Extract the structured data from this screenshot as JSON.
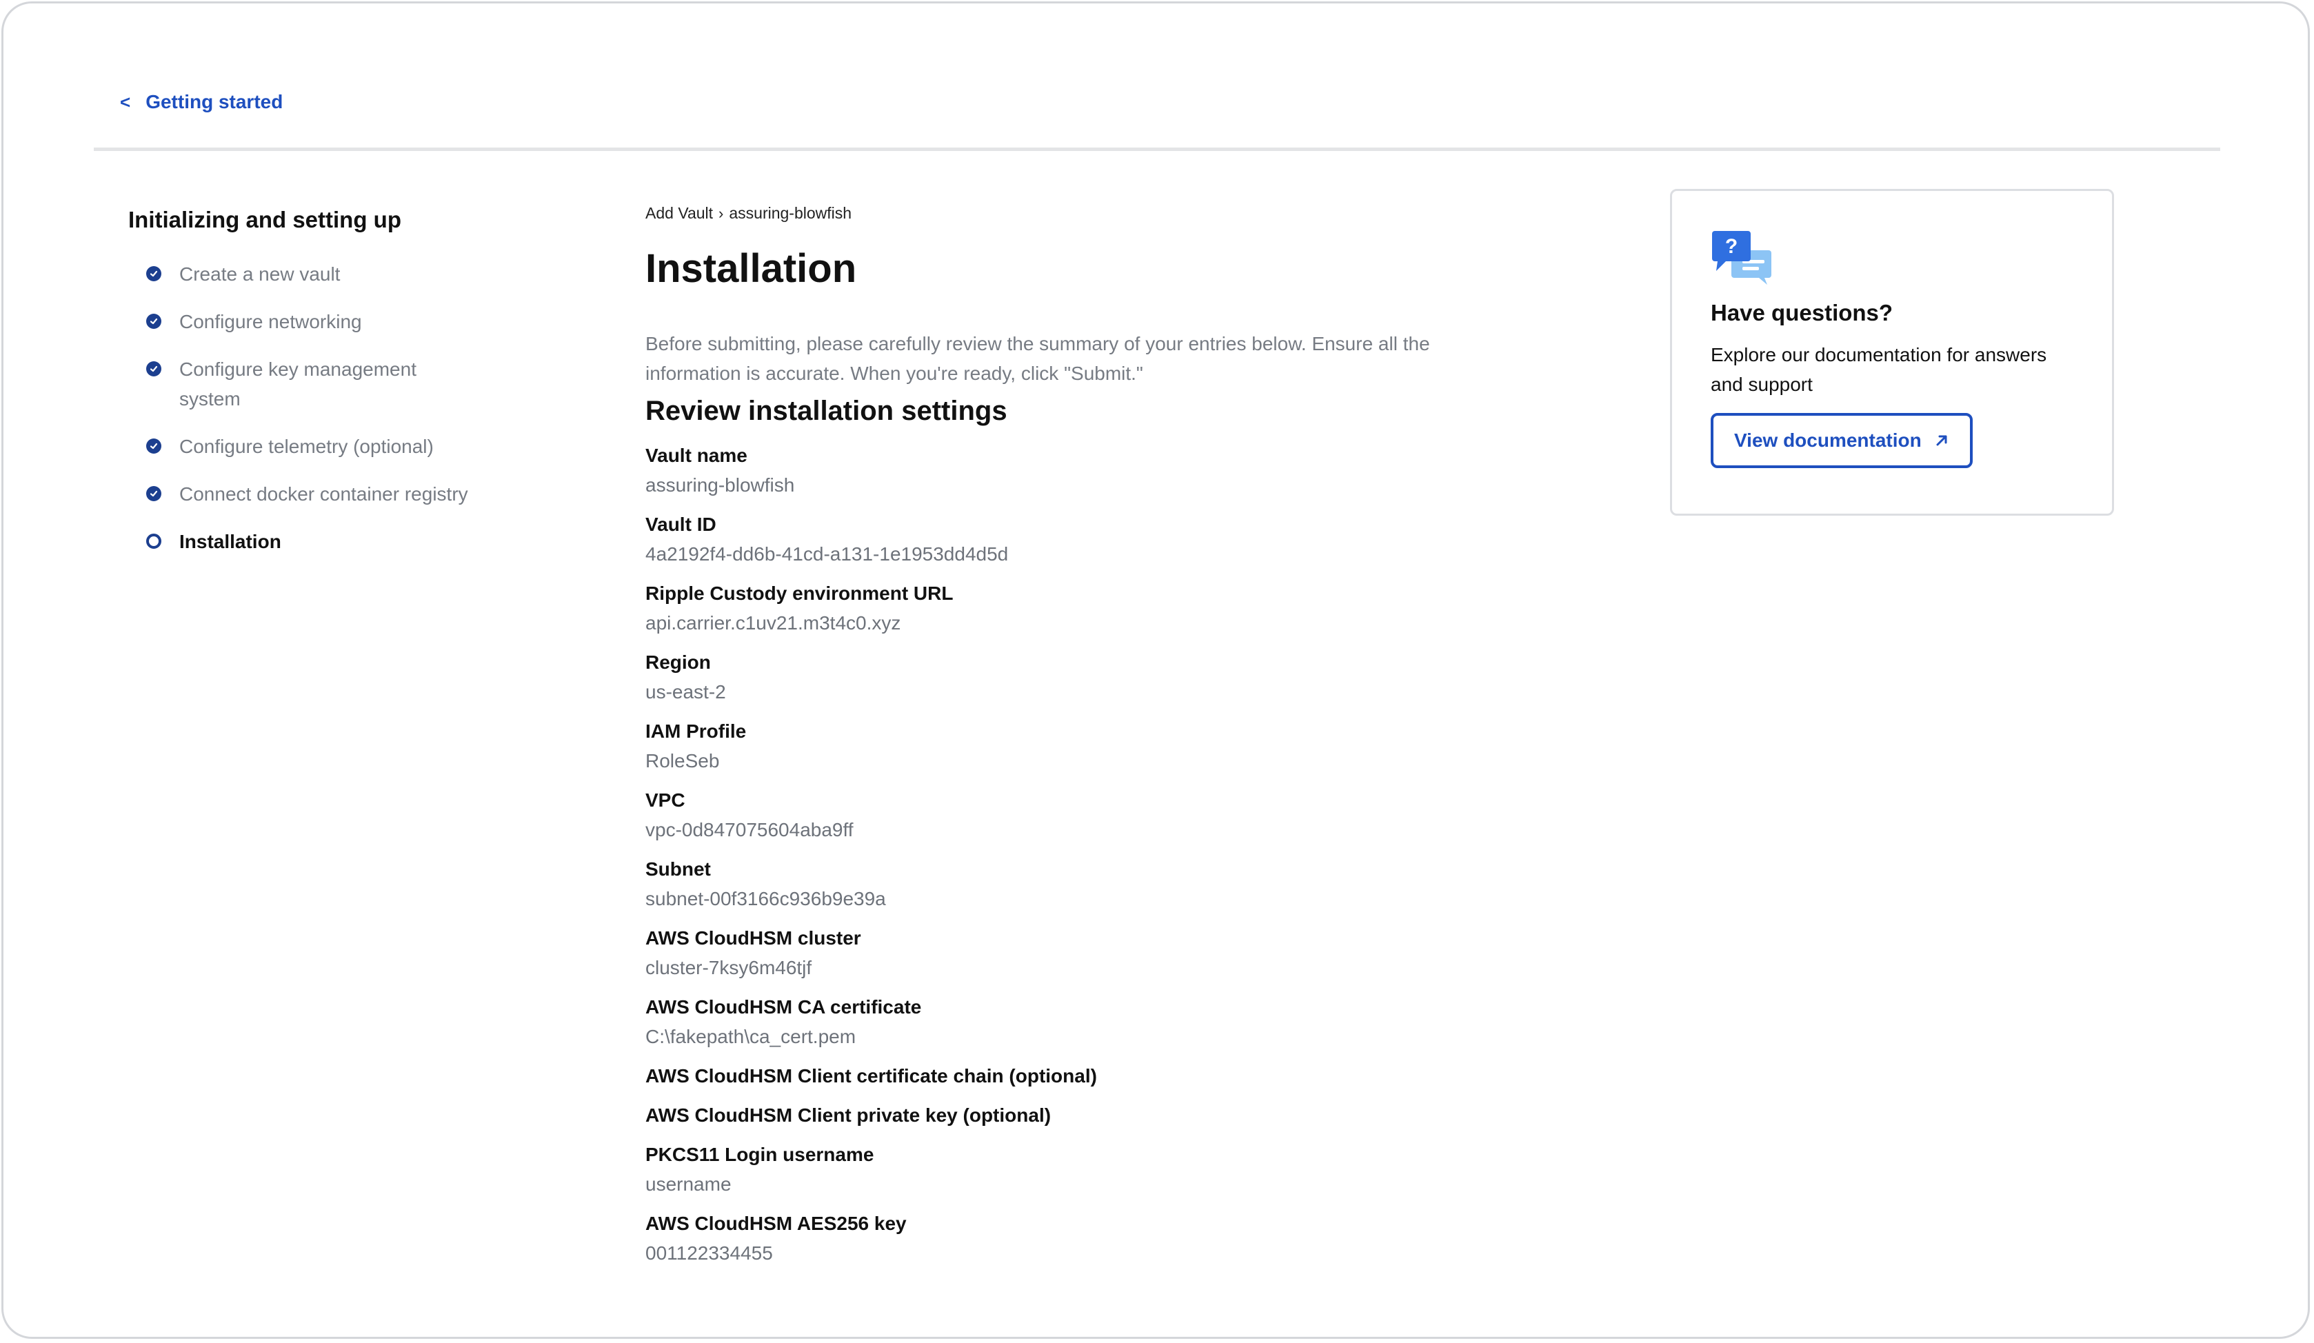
{
  "nav": {
    "back_label": "Getting started",
    "back_chevron": "<"
  },
  "sidebar": {
    "title": "Initializing and setting up",
    "steps": [
      {
        "label": "Create a new vault",
        "status": "done"
      },
      {
        "label": "Configure networking",
        "status": "done"
      },
      {
        "label": "Configure key management system",
        "status": "done"
      },
      {
        "label": "Configure telemetry (optional)",
        "status": "done"
      },
      {
        "label": "Connect docker container registry",
        "status": "done"
      },
      {
        "label": "Installation",
        "status": "current"
      }
    ]
  },
  "main": {
    "breadcrumb": {
      "parent": "Add Vault",
      "separator": "›",
      "current": "assuring-blowfish"
    },
    "title": "Installation",
    "intro": "Before submitting, please carefully review the summary of your entries below. Ensure all the information is accurate. When you're ready, click \"Submit.\"",
    "section_title": "Review installation settings",
    "fields": [
      {
        "label": "Vault name",
        "value": "assuring-blowfish"
      },
      {
        "label": "Vault ID",
        "value": "4a2192f4-dd6b-41cd-a131-1e1953dd4d5d"
      },
      {
        "label": "Ripple Custody environment URL",
        "value": "api.carrier.c1uv21.m3t4c0.xyz"
      },
      {
        "label": "Region",
        "value": "us-east-2"
      },
      {
        "label": "IAM Profile",
        "value": "RoleSeb"
      },
      {
        "label": "VPC",
        "value": "vpc-0d847075604aba9ff"
      },
      {
        "label": "Subnet",
        "value": "subnet-00f3166c936b9e39a"
      },
      {
        "label": "AWS CloudHSM cluster",
        "value": "cluster-7ksy6m46tjf"
      },
      {
        "label": "AWS CloudHSM CA certificate",
        "value": "C:\\fakepath\\ca_cert.pem"
      },
      {
        "label": "AWS CloudHSM Client certificate chain (optional)",
        "value": ""
      },
      {
        "label": "AWS CloudHSM Client private key (optional)",
        "value": ""
      },
      {
        "label": "PKCS11 Login username",
        "value": "username"
      },
      {
        "label": "AWS CloudHSM AES256 key",
        "value": "001122334455"
      }
    ]
  },
  "help": {
    "icon": "question-chat-icon",
    "title": "Have questions?",
    "text": "Explore our documentation for answers and support",
    "button_label": "View documentation",
    "button_icon": "external-arrow-icon"
  },
  "colors": {
    "accent": "#1e4fbf",
    "step_mark": "#1c3f8f",
    "muted_text": "#767b83",
    "border": "#dcdee2"
  }
}
